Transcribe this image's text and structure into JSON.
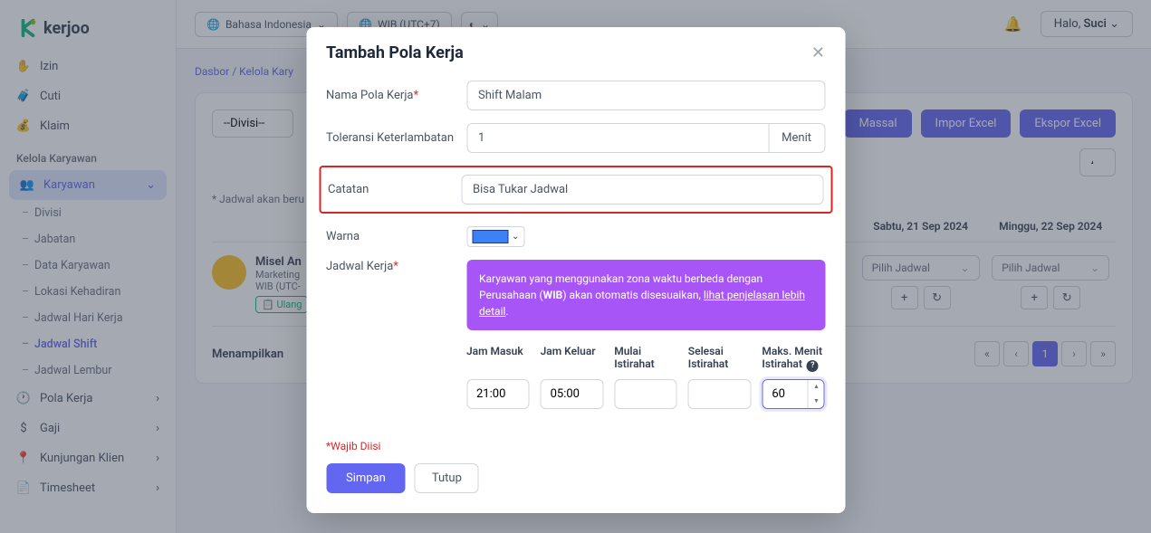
{
  "brand": "kerjoo",
  "topbar": {
    "language": "Bahasa Indonesia",
    "timezone": "WIB (UTC+7)",
    "greeting_prefix": "Halo, ",
    "greeting_user": "Suci"
  },
  "sidebar": {
    "izin": "Izin",
    "cuti": "Cuti",
    "klaim": "Klaim",
    "section_title": "Kelola Karyawan",
    "karyawan": "Karyawan",
    "divisi": "Divisi",
    "jabatan": "Jabatan",
    "data_karyawan": "Data Karyawan",
    "lokasi": "Lokasi Kehadiran",
    "jadwal_hari": "Jadwal Hari Kerja",
    "jadwal_shift": "Jadwal Shift",
    "jadwal_lembur": "Jadwal Lembur",
    "pola_kerja": "Pola Kerja",
    "gaji": "Gaji",
    "kunjungan": "Kunjungan Klien",
    "timesheet": "Timesheet"
  },
  "breadcrumb": {
    "a": "Dasbor",
    "b": "Kelola Kary"
  },
  "page": {
    "divisi_placeholder": "--Divisi--",
    "massal": "Massal",
    "impor": "Impor Excel",
    "ekspor": "Ekspor Excel",
    "note": "* Jadwal akan beru",
    "year_sel": "4",
    "day1": "Sabtu, 21 Sep 2024",
    "day2": "Minggu, 22 Sep 2024",
    "emp_name": "Misel An",
    "emp_role_prefix": "Marketing",
    "emp_tz": "WIB (UTC-",
    "badge_ulang": "Ulang",
    "pilih": "Pilih Jadwal",
    "menampilkan": "Menampilkan "
  },
  "modal": {
    "title": "Tambah Pola Kerja",
    "label_nama": "Nama Pola Kerja",
    "value_nama": "Shift Malam",
    "label_toleransi": "Toleransi Keterlambatan",
    "value_toleransi": "1",
    "addon_menit": "Menit",
    "label_catatan": "Catatan",
    "value_catatan": "Bisa Tukar Jadwal",
    "label_warna": "Warna",
    "label_jadwal": "Jadwal Kerja",
    "info_prefix": "Karyawan yang menggunakan zona waktu berbeda dengan Perusahaan (",
    "info_bold": "WIB",
    "info_suffix": ") akan otomatis disesuaikan, ",
    "info_link": "lihat penjelasan lebih detail",
    "info_dot": ".",
    "th_masuk": "Jam Masuk",
    "th_keluar": "Jam Keluar",
    "th_mulai": "Mulai Istirahat",
    "th_selesai": "Selesai Istirahat",
    "th_maks": "Maks. Menit Istirahat",
    "val_masuk": "21:00",
    "val_keluar": "05:00",
    "val_mulai": "",
    "val_selesai": "",
    "val_maks": "60",
    "wajib": "*Wajib Diisi",
    "simpan": "Simpan",
    "tutup": "Tutup"
  }
}
